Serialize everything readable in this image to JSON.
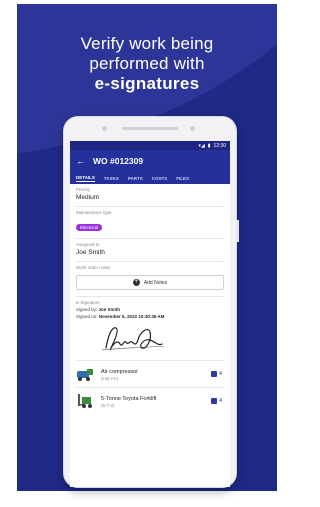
{
  "headline": {
    "line1": "Verify work being",
    "line2": "performed with",
    "line3": "e-signatures"
  },
  "status_bar": {
    "time": "12:30"
  },
  "app_bar": {
    "back_icon": "arrow-left-icon",
    "title": "WO #012309"
  },
  "tabs": [
    "DETAILS",
    "TASKS",
    "PARTS",
    "COSTS",
    "FILES"
  ],
  "fields": {
    "priority": {
      "label": "Priority",
      "value": "Medium"
    },
    "maintenance_type": {
      "label": "Maintenance type",
      "chip": "Electrical"
    },
    "assigned_to": {
      "label": "Assigned to",
      "value": "Joe Smith"
    },
    "notes": {
      "label": "Work order notes",
      "button": "Add Notes"
    }
  },
  "signature": {
    "label": "E-Signature",
    "signed_by_label": "Signed by:",
    "signed_by": "Joe Smith",
    "signed_on_label": "Signed on:",
    "signed_on": "November 6, 2022 10:30:45 AM"
  },
  "assets": [
    {
      "name": "Air compressor",
      "code": "(HQ-AC)",
      "count": "4"
    },
    {
      "name": "5-Tonne Toyota Forklift",
      "code": "(5-T-2)",
      "count": "4"
    }
  ],
  "colors": {
    "poster_bg": "#1e2a86",
    "app_bar": "#25319a",
    "chip": "#9b2fe0"
  }
}
